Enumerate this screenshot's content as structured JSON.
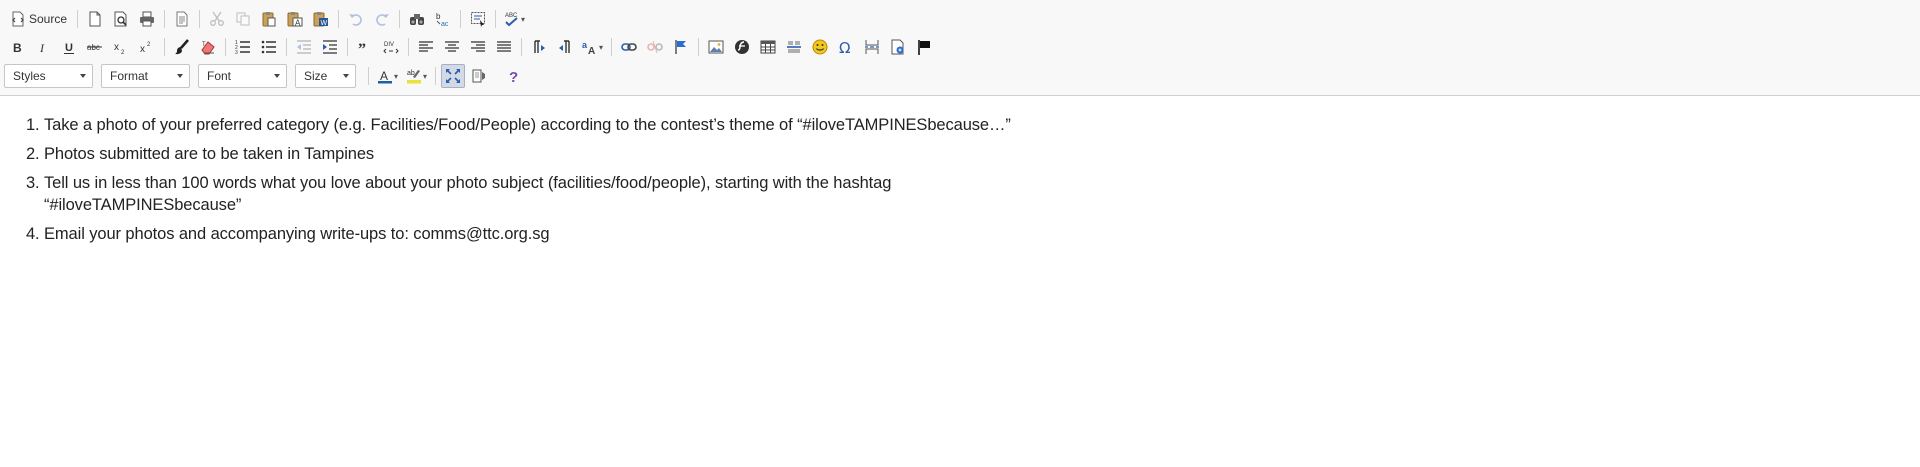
{
  "toolbar": {
    "source_label": "Source",
    "combos": {
      "styles": "Styles",
      "format": "Format",
      "font": "Font",
      "size": "Size"
    },
    "accent_color": "#1f6fb5",
    "text_color_swatch": "#1f5fa8",
    "bg_color_swatch": "#e8e23a",
    "help_color": "#7b4ab5"
  },
  "content": {
    "items": [
      "Take a photo of your preferred category (e.g. Facilities/Food/People) according to the contest’s theme of “#iloveTAMPINESbecause…”",
      "Photos submitted are to be taken in Tampines",
      "Tell us in less than 100 words what you love about your photo subject (facilities/food/people), starting with the hashtag “#iloveTAMPINESbecause”",
      "Email your photos and accompanying write-ups to: comms@ttc.org.sg"
    ]
  }
}
